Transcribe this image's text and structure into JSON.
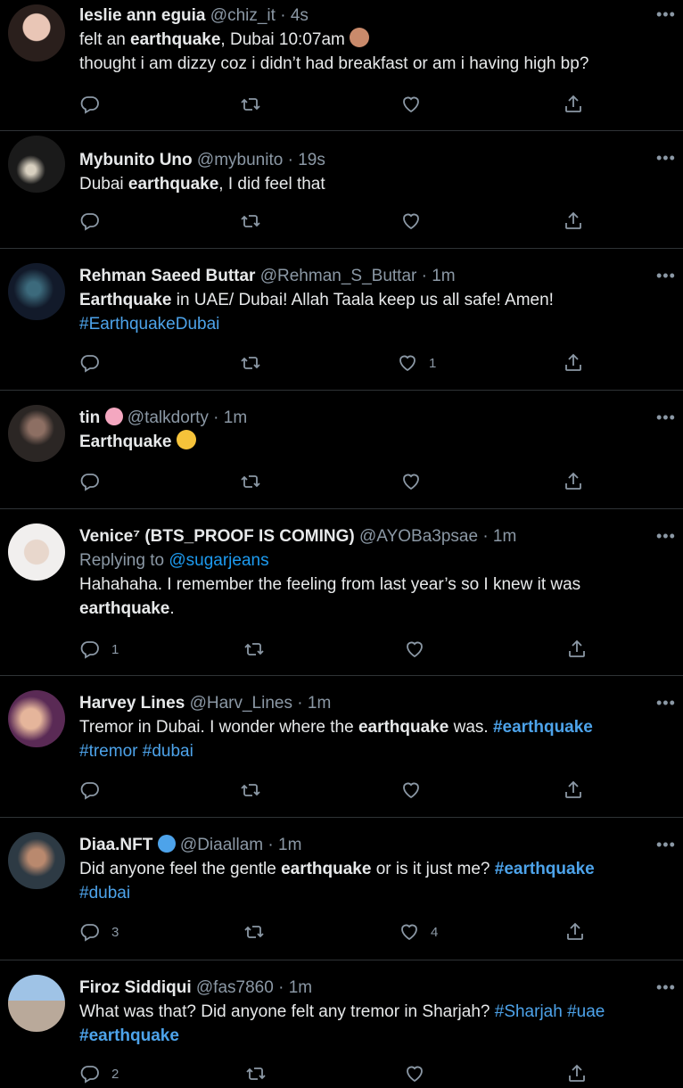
{
  "tweets": [
    {
      "name": "leslie ann eguia",
      "handle": "@chiz_it",
      "time": "4s",
      "line1_a": "felt an ",
      "line1_b": "earthquake",
      "line1_c": ", Dubai 10:07am",
      "line2": "thought i am dizzy coz i didn’t had breakfast or am i having high bp?",
      "replies": "",
      "likes": ""
    },
    {
      "name": "Mybunito Uno",
      "handle": "@mybunito",
      "time": "19s",
      "line1_a": "Dubai ",
      "line1_b": "earthquake",
      "line1_c": ", I did feel that",
      "replies": "",
      "likes": ""
    },
    {
      "name": "Rehman Saeed Buttar",
      "handle": "@Rehman_S_Buttar",
      "time": "1m",
      "line1_b": "Earthquake",
      "line1_c": " in UAE/ Dubai! Allah Taala keep us all safe! Amen!",
      "tag1": "#EarthquakeDubai",
      "replies": "",
      "likes": "1"
    },
    {
      "name": "tin",
      "handle": "@talkdorty",
      "time": "1m",
      "line1_b": "Earthquake",
      "replies": "",
      "likes": ""
    },
    {
      "name": "Venice⁷ (BTS_PROOF IS COMING)",
      "handle": "@AYOBa3psae",
      "time": "1m",
      "replying_label": "Replying to",
      "replying_to": "@sugarjeans",
      "line1_a": "Hahahaha. I remember the feeling from last year’s so I knew it was",
      "line2_b": "earthquake",
      "line2_c": ".",
      "replies": "1",
      "likes": ""
    },
    {
      "name": "Harvey Lines",
      "handle": "@Harv_Lines",
      "time": "1m",
      "line1_a": "Tremor in Dubai. I wonder where the ",
      "line1_b": "earthquake",
      "line1_c": " was. ",
      "tag1": "#earthquake",
      "tag2": "#tremor",
      "tag3": "#dubai",
      "replies": "",
      "likes": ""
    },
    {
      "name": "Diaa.NFT",
      "handle": "@Diaallam",
      "time": "1m",
      "line1_a": "Did anyone feel the gentle ",
      "line1_b": "earthquake",
      "line1_c": " or is it just me? ",
      "tag1": "#earthquake",
      "tag2": "#dubai",
      "replies": "3",
      "likes": "4"
    },
    {
      "name": "Firoz Siddiqui",
      "handle": "@fas7860",
      "time": "1m",
      "line1_a": "What was that? Did anyone felt any tremor in Sharjah? ",
      "tag1": "#Sharjah",
      "tag2": "#uae",
      "tag3": "#earthquake",
      "replies": "2",
      "likes": ""
    }
  ],
  "icons": {
    "reply": "reply-icon",
    "retweet": "retweet-icon",
    "like": "heart-icon",
    "share": "share-icon",
    "more": "more-icon"
  },
  "colors": {
    "background": "#000000",
    "text": "#e7e9ea",
    "muted": "#8b98a5",
    "link": "#1d9bf0",
    "divider": "#2f3336"
  }
}
